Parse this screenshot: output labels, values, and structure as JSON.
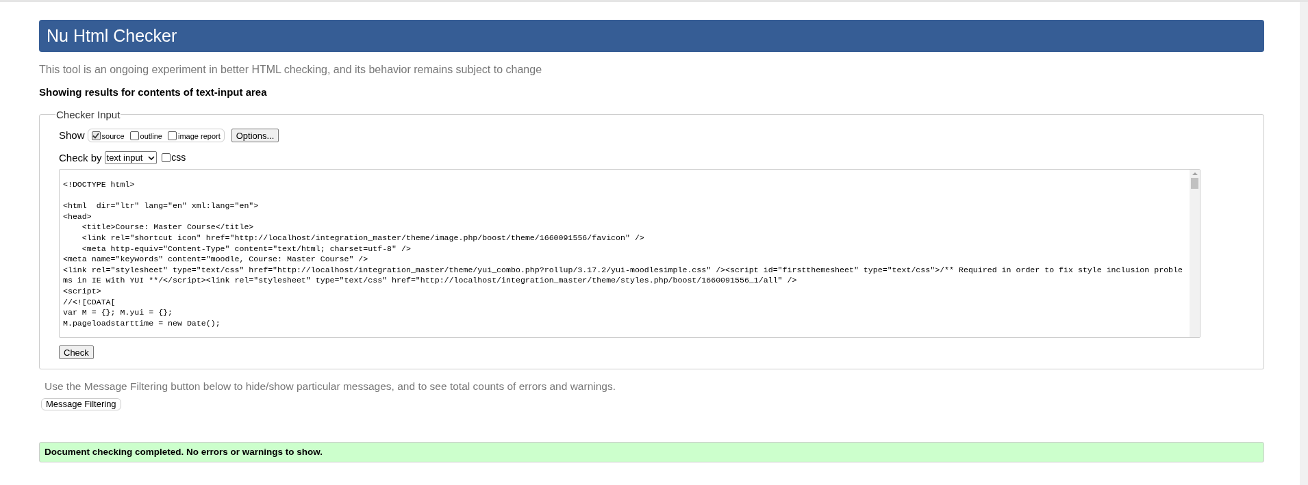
{
  "header": {
    "title": "Nu Html Checker"
  },
  "intro": "This tool is an ongoing experiment in better HTML checking, and its behavior remains subject to change",
  "results_heading": "Showing results for contents of text-input area",
  "checker_input": {
    "legend": "Checker Input",
    "show_label": "Show",
    "show_options": [
      {
        "label": "source",
        "checked": true
      },
      {
        "label": "outline",
        "checked": false
      },
      {
        "label": "image report",
        "checked": false
      }
    ],
    "options_button": "Options...",
    "check_by_label": "Check by",
    "check_by_select": "text input",
    "css": {
      "label": "css",
      "checked": false
    },
    "source_code": "<!DOCTYPE html>\n\n<html  dir=\"ltr\" lang=\"en\" xml:lang=\"en\">\n<head>\n    <title>Course: Master Course</title>\n    <link rel=\"shortcut icon\" href=\"http://localhost/integration_master/theme/image.php/boost/theme/1660091556/favicon\" />\n    <meta http-equiv=\"Content-Type\" content=\"text/html; charset=utf-8\" />\n<meta name=\"keywords\" content=\"moodle, Course: Master Course\" />\n<link rel=\"stylesheet\" type=\"text/css\" href=\"http://localhost/integration_master/theme/yui_combo.php?rollup/3.17.2/yui-moodlesimple.css\" /><script id=\"firstthemesheet\" type=\"text/css\">/** Required in order to fix style inclusion problems in IE with YUI **/</script><link rel=\"stylesheet\" type=\"text/css\" href=\"http://localhost/integration_master/theme/styles.php/boost/1660091556_1/all\" />\n<script>\n//<![CDATA[\nvar M = {}; M.yui = {};\nM.pageloadstarttime = new Date();",
    "check_button": "Check"
  },
  "filter_hint": "Use the Message Filtering button below to hide/show particular messages, and to see total counts of errors and warnings.",
  "filter_button": "Message Filtering",
  "result_message": "Document checking completed. No errors or warnings to show."
}
